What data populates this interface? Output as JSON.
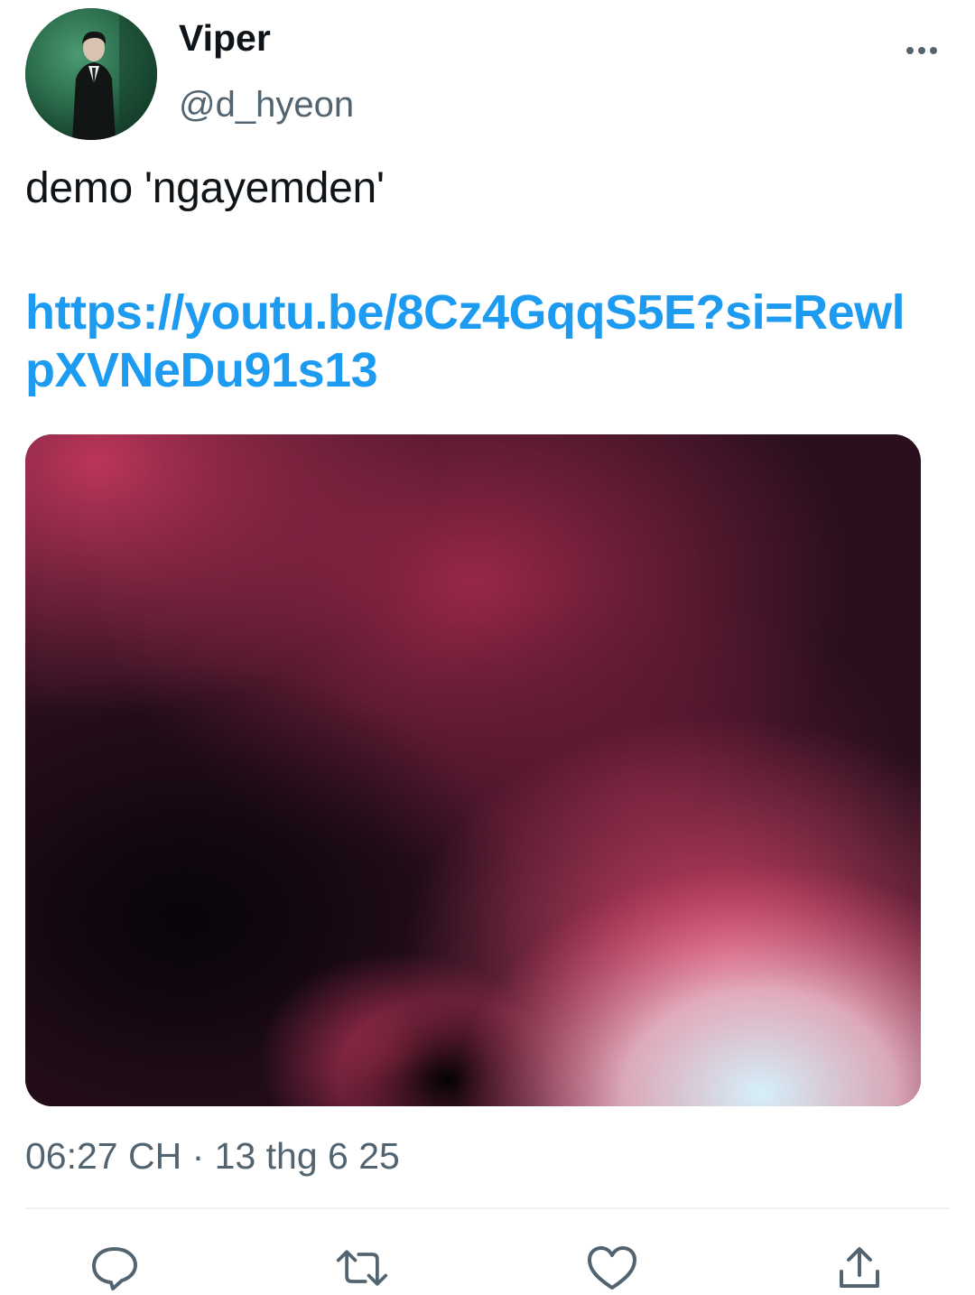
{
  "tweet": {
    "author": {
      "display_name": "Viper",
      "handle": "@d_hyeon"
    },
    "text": "demo 'ngayemden'",
    "link": "https://youtu.be/8Cz4GqqS5E?si=RewlpXVNeDu91s13",
    "media": {
      "kind": "image",
      "description_icon": "abstract-gradient-image"
    },
    "timestamp": "06:27 CH · 13 thg 6 25"
  },
  "icons": {
    "more": "more-horizontal-icon",
    "reply": "reply-icon",
    "retweet": "retweet-icon",
    "like": "heart-icon",
    "share": "share-icon"
  },
  "colors": {
    "text": "#0f1419",
    "secondary": "#536471",
    "link": "#1d9bf0",
    "divider": "#eff3f4",
    "icon": "#536471"
  }
}
